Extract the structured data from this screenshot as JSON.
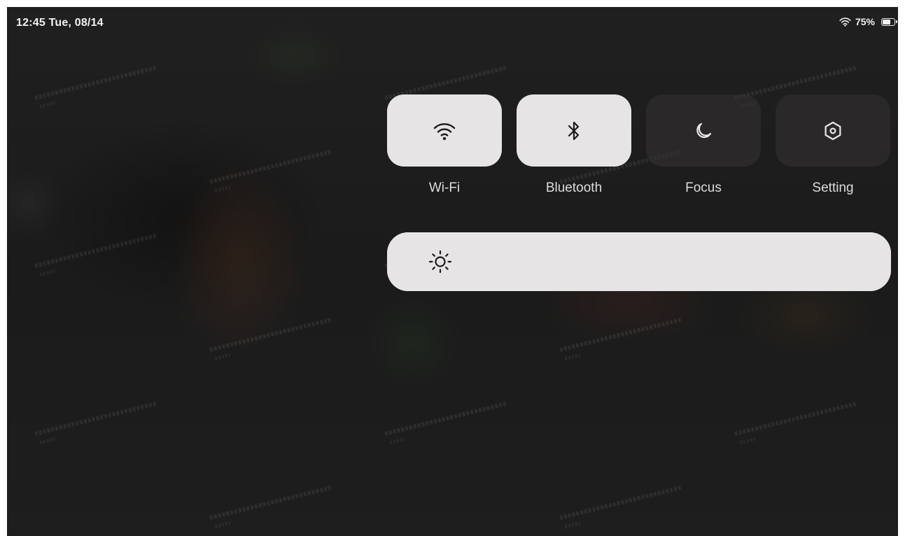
{
  "status_bar": {
    "time": "12:45",
    "date": "Tue, 08/14",
    "battery_percent": "75%",
    "battery_level": 0.75
  },
  "control_center": {
    "tiles": [
      {
        "label": "Wi-Fi",
        "icon": "wifi-icon",
        "active": true
      },
      {
        "label": "Bluetooth",
        "icon": "bluetooth-icon",
        "active": true
      },
      {
        "label": "Focus",
        "icon": "moon-icon",
        "active": false
      },
      {
        "label": "Setting",
        "icon": "settings-icon",
        "active": false
      }
    ],
    "brightness": {
      "icon": "sun-icon",
      "level": 1.0
    }
  },
  "colors": {
    "tile_active": "#e7e4e5",
    "tile_inactive": "#343232",
    "icon_dark": "#1a1a1a",
    "icon_light": "#e8e8e8",
    "label_text": "#dcdcdc"
  }
}
